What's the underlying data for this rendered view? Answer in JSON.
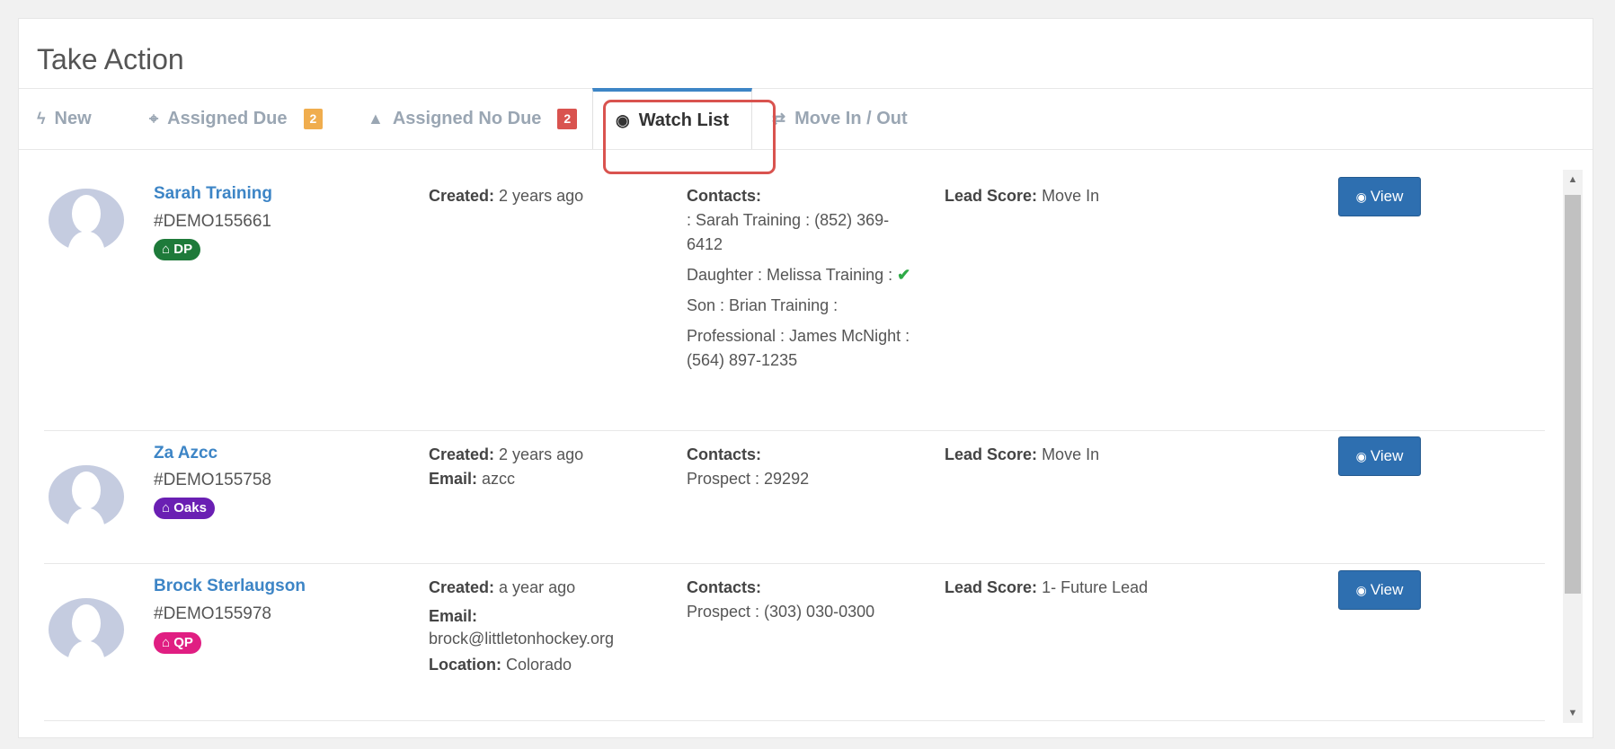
{
  "panel": {
    "title": "Take Action"
  },
  "tabs": [
    {
      "label": "New",
      "icon": "bolt-icon",
      "glyph": "ϟ"
    },
    {
      "label": "Assigned Due",
      "icon": "crosshair-icon",
      "glyph": "⌖",
      "badge": "2",
      "badge_color": "#f0ad4e"
    },
    {
      "label": "Assigned No Due",
      "icon": "warning-icon",
      "glyph": "▲",
      "badge": "2",
      "badge_color": "#d9534f"
    },
    {
      "label": "Watch List",
      "icon": "eye-icon",
      "glyph": "◉"
    },
    {
      "label": "Move In / Out",
      "icon": "exchange-icon",
      "glyph": "⇄"
    }
  ],
  "labels": {
    "created": "Created:",
    "email": "Email:",
    "location": "Location:",
    "contacts": "Contacts:",
    "lead_score": "Lead Score:",
    "view": "View"
  },
  "rows": [
    {
      "name": "Sarah Training",
      "code": "#DEMO155661",
      "tag": "DP",
      "tag_color": "#1e7a3a",
      "created": "2 years ago",
      "contacts": [
        ": Sarah Training : (852) 369-6412",
        "Daughter : Melissa Training :",
        "Son : Brian Training :",
        "Professional : James McNight : (564) 897-1235"
      ],
      "check_mark": "✔",
      "lead_score": "Move In"
    },
    {
      "name": "Za Azcc",
      "code": "#DEMO155758",
      "tag": "Oaks",
      "tag_color": "#6a1fb3",
      "created": "2 years ago",
      "email": "azcc",
      "contacts": [
        "Prospect : 29292"
      ],
      "lead_score": "Move In"
    },
    {
      "name": "Brock Sterlaugson",
      "code": "#DEMO155978",
      "tag": "QP",
      "tag_color": "#e01e82",
      "created": "a year ago",
      "email": "brock@littletonhockey.org",
      "location": "Colorado",
      "contacts": [
        "Prospect : (303) 030-0300"
      ],
      "lead_score": "1- Future Lead"
    }
  ],
  "colors": {
    "link": "#3d85c6",
    "view_button": "#2e6fb0",
    "highlight": "#d9534f",
    "avatar": "#c5cce0"
  }
}
